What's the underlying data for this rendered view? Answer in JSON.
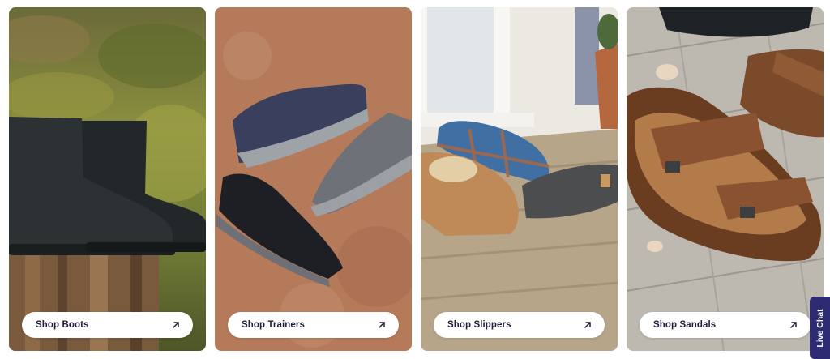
{
  "categories": [
    {
      "label": "Shop Boots",
      "icon": "arrow-up-right-icon"
    },
    {
      "label": "Shop Trainers",
      "icon": "arrow-up-right-icon"
    },
    {
      "label": "Shop Slippers",
      "icon": "arrow-up-right-icon"
    },
    {
      "label": "Shop Sandals",
      "icon": "arrow-up-right-icon"
    }
  ],
  "live_chat": {
    "label": "Live Chat",
    "color": "#2f2b73"
  },
  "colors": {
    "button_bg": "#ffffff",
    "button_text": "#1f1f3a"
  }
}
